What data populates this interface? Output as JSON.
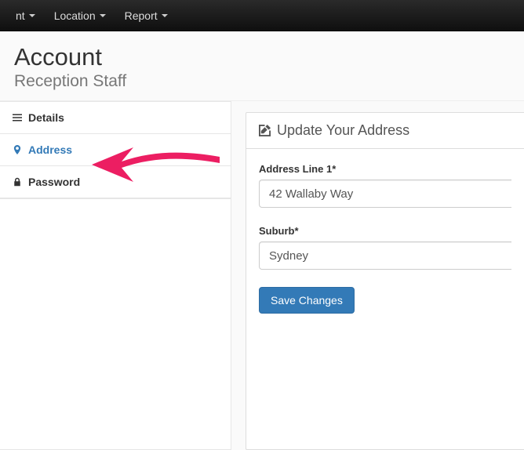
{
  "navbar": {
    "items": [
      {
        "label": "nt"
      },
      {
        "label": "Location"
      },
      {
        "label": "Report"
      }
    ]
  },
  "header": {
    "title": "Account",
    "subtitle": "Reception Staff"
  },
  "sidenav": {
    "items": [
      {
        "label": "Details",
        "icon": "list-icon",
        "active": false
      },
      {
        "label": "Address",
        "icon": "map-marker-icon",
        "active": true
      },
      {
        "label": "Password",
        "icon": "lock-icon",
        "active": false
      }
    ]
  },
  "panel": {
    "title": "Update Your Address",
    "form": {
      "address_line_1": {
        "label": "Address Line 1*",
        "value": "42 Wallaby Way"
      },
      "suburb": {
        "label": "Suburb*",
        "value": "Sydney"
      },
      "submit_label": "Save Changes"
    }
  },
  "annotation": {
    "arrow_color": "#ec1e62"
  }
}
